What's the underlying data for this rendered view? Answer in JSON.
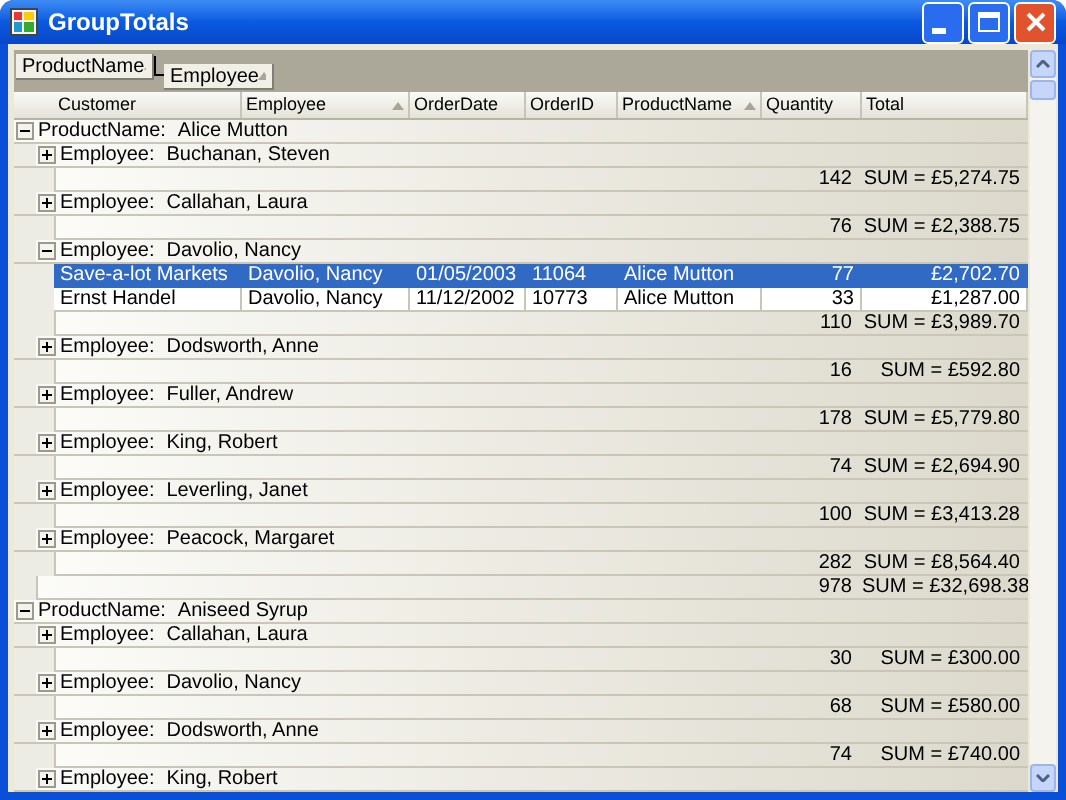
{
  "window": {
    "title": "GroupTotals"
  },
  "group_panel": [
    {
      "label": "ProductName"
    },
    {
      "label": "Employee"
    }
  ],
  "columns": [
    {
      "label": "Customer",
      "sorted": false
    },
    {
      "label": "Employee",
      "sorted": true
    },
    {
      "label": "OrderDate",
      "sorted": false
    },
    {
      "label": "OrderID",
      "sorted": false
    },
    {
      "label": "ProductName",
      "sorted": true
    },
    {
      "label": "Quantity",
      "sorted": false
    },
    {
      "label": "Total",
      "sorted": false
    }
  ],
  "groups": [
    {
      "field": "ProductName:",
      "value": "Alice Mutton",
      "expanded": true,
      "quantity_sum": "978",
      "total_sum": "SUM = £32,698.38",
      "subgroups": [
        {
          "field": "Employee:",
          "value": "Buchanan, Steven",
          "expanded": false,
          "quantity_sum": "142",
          "total_sum": "SUM = £5,274.75"
        },
        {
          "field": "Employee:",
          "value": "Callahan, Laura",
          "expanded": false,
          "quantity_sum": "76",
          "total_sum": "SUM = £2,388.75"
        },
        {
          "field": "Employee:",
          "value": "Davolio, Nancy",
          "expanded": true,
          "quantity_sum": "110",
          "total_sum": "SUM = £3,989.70",
          "rows": [
            {
              "selected": true,
              "cells": [
                "Save-a-lot Markets",
                "Davolio, Nancy",
                "01/05/2003",
                "11064",
                "Alice Mutton",
                "77",
                "£2,702.70"
              ]
            },
            {
              "selected": false,
              "cells": [
                "Ernst Handel",
                "Davolio, Nancy",
                "11/12/2002",
                "10773",
                "Alice Mutton",
                "33",
                "£1,287.00"
              ]
            }
          ]
        },
        {
          "field": "Employee:",
          "value": "Dodsworth, Anne",
          "expanded": false,
          "quantity_sum": "16",
          "total_sum": "SUM = £592.80"
        },
        {
          "field": "Employee:",
          "value": "Fuller, Andrew",
          "expanded": false,
          "quantity_sum": "178",
          "total_sum": "SUM = £5,779.80"
        },
        {
          "field": "Employee:",
          "value": "King, Robert",
          "expanded": false,
          "quantity_sum": "74",
          "total_sum": "SUM = £2,694.90"
        },
        {
          "field": "Employee:",
          "value": "Leverling, Janet",
          "expanded": false,
          "quantity_sum": "100",
          "total_sum": "SUM = £3,413.28"
        },
        {
          "field": "Employee:",
          "value": "Peacock, Margaret",
          "expanded": false,
          "quantity_sum": "282",
          "total_sum": "SUM = £8,564.40"
        }
      ]
    },
    {
      "field": "ProductName:",
      "value": "Aniseed Syrup",
      "expanded": true,
      "subgroups": [
        {
          "field": "Employee:",
          "value": "Callahan, Laura",
          "expanded": false,
          "quantity_sum": "30",
          "total_sum": "SUM = £300.00"
        },
        {
          "field": "Employee:",
          "value": "Davolio, Nancy",
          "expanded": false,
          "quantity_sum": "68",
          "total_sum": "SUM = £580.00"
        },
        {
          "field": "Employee:",
          "value": "Dodsworth, Anne",
          "expanded": false,
          "quantity_sum": "74",
          "total_sum": "SUM = £740.00"
        },
        {
          "field": "Employee:",
          "value": "King, Robert",
          "expanded": false
        }
      ]
    }
  ]
}
